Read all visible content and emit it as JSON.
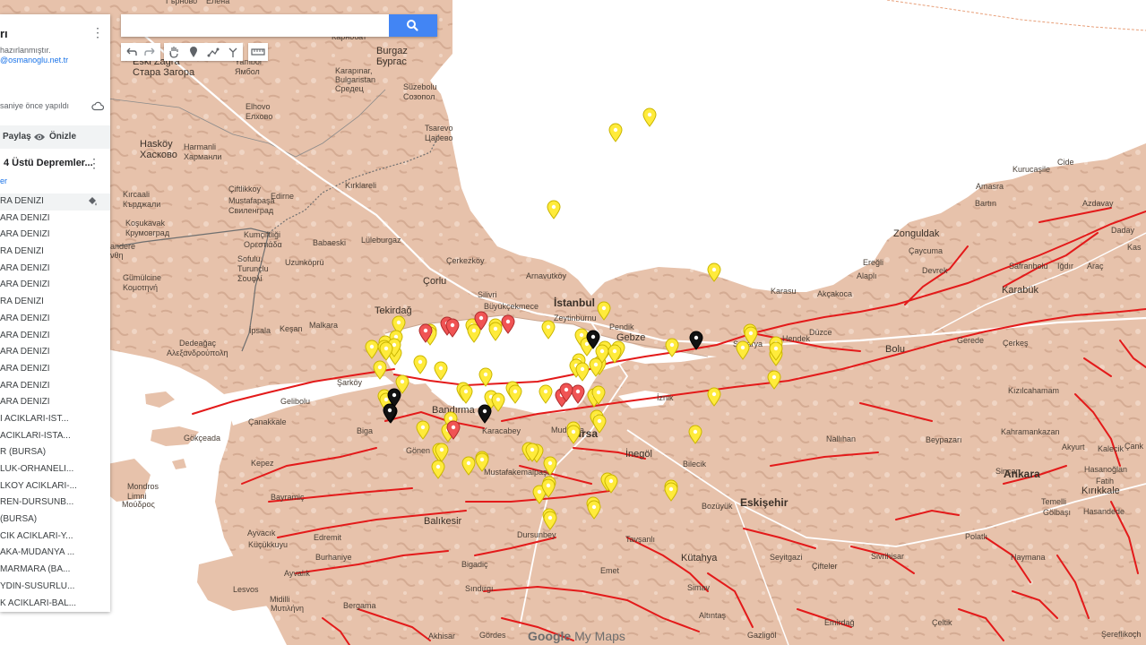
{
  "search": {
    "placeholder": ""
  },
  "panel": {
    "title": "rı",
    "description_line1": "hazırlanmıştır.",
    "description_line2": "@osmanoglu.net.tr",
    "saved_text": "saniye önce yapıldı",
    "share_label": "Paylaş",
    "preview_label": "Önizle",
    "layer_title": "4 Üstü Depremler...",
    "layer_sub": "er",
    "items": [
      "RA DENIZI",
      "ARA DENIZI",
      "ARA DENIZI",
      "RA DENIZI",
      "ARA DENIZI",
      "ARA DENIZI",
      "RA DENIZI",
      "ARA DENIZI",
      "ARA DENIZI",
      "ARA DENIZI",
      "ARA DENIZI",
      "ARA DENIZI",
      "ARA DENIZI",
      "I ACIKLARI-IST...",
      "ACIKLARI-ISTA...",
      "R (BURSA)",
      "LUK-ORHANELI...",
      "LKOY ACIKLARI-...",
      "REN-DURSUNB...",
      "(BURSA)",
      "CIK ACIKLARI-Y...",
      "AKA-MUDANYA ...",
      "MARMARA (BA...",
      "YDIN-SUSURLU...",
      "K ACIKLARI-BAL..."
    ]
  },
  "map": {
    "watermark_google": "Google",
    "watermark_mymaps": "My Maps",
    "labels": [
      {
        "t": "Гърново",
        "s": "sm"
      },
      {
        "t": "Елена",
        "s": "sm"
      },
      {
        "t": "Карнобат",
        "s": "sm"
      },
      {
        "t": "Burgaz",
        "s": "md"
      },
      {
        "t": "Бургас",
        "s": "md"
      },
      {
        "t": "Eski Zagra",
        "s": "md"
      },
      {
        "t": "Стара Загора",
        "s": "md"
      },
      {
        "t": "Yambol",
        "s": "sm"
      },
      {
        "t": "Ямбол",
        "s": "sm"
      },
      {
        "t": "Karapınar,",
        "s": "sm"
      },
      {
        "t": "Bulgaristan",
        "s": "sm"
      },
      {
        "t": "Средец",
        "s": "sm"
      },
      {
        "t": "Süzebolu",
        "s": "sm"
      },
      {
        "t": "Созопол",
        "s": "sm"
      },
      {
        "t": "Elhovo",
        "s": "sm"
      },
      {
        "t": "Елхово",
        "s": "sm"
      },
      {
        "t": "Tsarevo",
        "s": "sm"
      },
      {
        "t": "Царево",
        "s": "sm"
      },
      {
        "t": "Hasköy",
        "s": "md"
      },
      {
        "t": "Хасково",
        "s": "md"
      },
      {
        "t": "Harmanli",
        "s": "sm"
      },
      {
        "t": "Харманли",
        "s": "sm"
      },
      {
        "t": "Kırcaali",
        "s": "sm"
      },
      {
        "t": "Кърджали",
        "s": "sm"
      },
      {
        "t": "Kırklareli",
        "s": "sm"
      },
      {
        "t": "Koşukavak",
        "s": "sm"
      },
      {
        "t": "Крумовград",
        "s": "sm"
      },
      {
        "t": "Çiftlikkoy",
        "s": "sm"
      },
      {
        "t": "Mustafapaşa",
        "s": "sm"
      },
      {
        "t": "Свиленград",
        "s": "sm"
      },
      {
        "t": "Edirne",
        "s": "sm"
      },
      {
        "t": "Kumçiftliği",
        "s": "sm"
      },
      {
        "t": "Ορεστιάδα",
        "s": "sm"
      },
      {
        "t": "Babaeski",
        "s": "sm"
      },
      {
        "t": "Lüleburgaz",
        "s": "sm"
      },
      {
        "t": "Sofulu,",
        "s": "sm"
      },
      {
        "t": "Turunçlu",
        "s": "sm"
      },
      {
        "t": "Σουφλί",
        "s": "sm"
      },
      {
        "t": "Uzunköprü",
        "s": "sm"
      },
      {
        "t": "Gümülcine",
        "s": "sm"
      },
      {
        "t": "Κομοτηνή",
        "s": "sm"
      },
      {
        "t": "andere",
        "s": "sm"
      },
      {
        "t": "νθη",
        "s": "sm"
      },
      {
        "t": "Çerkezköy",
        "s": "sm"
      },
      {
        "t": "Arnavutköy",
        "s": "sm"
      },
      {
        "t": "Çorlu",
        "s": "md"
      },
      {
        "t": "Tekirdağ",
        "s": "md"
      },
      {
        "t": "Silivri",
        "s": "sm"
      },
      {
        "t": "Büyükçekmece",
        "s": "sm"
      },
      {
        "t": "İstanbul",
        "s": "lg"
      },
      {
        "t": "Zeytinburnu",
        "s": "sm"
      },
      {
        "t": "Pendik",
        "s": "sm"
      },
      {
        "t": "Gebze",
        "s": "md"
      },
      {
        "t": "İpsala",
        "s": "sm"
      },
      {
        "t": "Keşan",
        "s": "sm"
      },
      {
        "t": "Malkara",
        "s": "sm"
      },
      {
        "t": "Dedeağaç",
        "s": "sm"
      },
      {
        "t": "Αλεξανδρούπολη",
        "s": "sm"
      },
      {
        "t": "Şarköy",
        "s": "sm"
      },
      {
        "t": "Gelibolu",
        "s": "sm"
      },
      {
        "t": "Bandırma",
        "s": "md"
      },
      {
        "t": "Mudanya",
        "s": "sm"
      },
      {
        "t": "Bursa",
        "s": "lg"
      },
      {
        "t": "Karacabey",
        "s": "sm"
      },
      {
        "t": "Gökçeada",
        "s": "sm"
      },
      {
        "t": "Biga",
        "s": "sm"
      },
      {
        "t": "Çanakkale",
        "s": "sm"
      },
      {
        "t": "Gönen",
        "s": "sm"
      },
      {
        "t": "Kepez",
        "s": "sm"
      },
      {
        "t": "Mustafakemalpaşa",
        "s": "sm"
      },
      {
        "t": "Mondros",
        "s": "sm"
      },
      {
        "t": "Limni",
        "s": "sm"
      },
      {
        "t": "Μούδρος",
        "s": "sm"
      },
      {
        "t": "Bayramiç",
        "s": "sm"
      },
      {
        "t": "Balıkesir",
        "s": "md"
      },
      {
        "t": "Dursunbey",
        "s": "sm"
      },
      {
        "t": "Ayvacık",
        "s": "sm"
      },
      {
        "t": "Edremit",
        "s": "sm"
      },
      {
        "t": "Küçükkuyu",
        "s": "sm"
      },
      {
        "t": "Burhaniye",
        "s": "sm"
      },
      {
        "t": "Bigadiç",
        "s": "sm"
      },
      {
        "t": "Sındırgı",
        "s": "sm"
      },
      {
        "t": "Ayvalık",
        "s": "sm"
      },
      {
        "t": "Lesvos",
        "s": "sm"
      },
      {
        "t": "Midilli",
        "s": "sm"
      },
      {
        "t": "Μυτιλήνη",
        "s": "sm"
      },
      {
        "t": "Bergama",
        "s": "sm"
      },
      {
        "t": "Akhisar",
        "s": "sm"
      },
      {
        "t": "Gördes",
        "s": "sm"
      },
      {
        "t": "Emet",
        "s": "sm"
      },
      {
        "t": "Tavşanlı",
        "s": "sm"
      },
      {
        "t": "Kütahya",
        "s": "md"
      },
      {
        "t": "Simav",
        "s": "sm"
      },
      {
        "t": "Altıntaş",
        "s": "sm"
      },
      {
        "t": "İnegöl",
        "s": "md"
      },
      {
        "t": "Bilecik",
        "s": "sm"
      },
      {
        "t": "Bozüyük",
        "s": "sm"
      },
      {
        "t": "Eskişehir",
        "s": "lg"
      },
      {
        "t": "Seyitgazi",
        "s": "sm"
      },
      {
        "t": "Çifteler",
        "s": "sm"
      },
      {
        "t": "Emirdağ",
        "s": "sm"
      },
      {
        "t": "Gazligöl",
        "s": "sm"
      },
      {
        "t": "Sivrihisar",
        "s": "sm"
      },
      {
        "t": "Polatlı",
        "s": "sm"
      },
      {
        "t": "Haymana",
        "s": "sm"
      },
      {
        "t": "Çeltik",
        "s": "sm"
      },
      {
        "t": "İznik",
        "s": "sm"
      },
      {
        "t": "Sakarya",
        "s": "sm"
      },
      {
        "t": "Hendek",
        "s": "sm"
      },
      {
        "t": "Düzce",
        "s": "sm"
      },
      {
        "t": "Bolu",
        "s": "md"
      },
      {
        "t": "Gerede",
        "s": "sm"
      },
      {
        "t": "Çerkeş",
        "s": "sm"
      },
      {
        "t": "Nallıhan",
        "s": "sm"
      },
      {
        "t": "Beypazarı",
        "s": "sm"
      },
      {
        "t": "Kızılcahamam",
        "s": "sm"
      },
      {
        "t": "Kahramankazan",
        "s": "sm"
      },
      {
        "t": "Akyurt",
        "s": "sm"
      },
      {
        "t": "Ankara",
        "s": "lg"
      },
      {
        "t": "Sincan",
        "s": "sm"
      },
      {
        "t": "Temelli",
        "s": "sm"
      },
      {
        "t": "Gölbaşı",
        "s": "sm"
      },
      {
        "t": "Hasanoğlan",
        "s": "sm"
      },
      {
        "t": "Fatih",
        "s": "sm"
      },
      {
        "t": "Kırıkkale",
        "s": "md"
      },
      {
        "t": "Hasandede",
        "s": "sm"
      },
      {
        "t": "Kalecik",
        "s": "sm"
      },
      {
        "t": "Çank",
        "s": "sm"
      },
      {
        "t": "Zonguldak",
        "s": "md"
      },
      {
        "t": "Çaycuma",
        "s": "sm"
      },
      {
        "t": "Ereğli",
        "s": "sm"
      },
      {
        "t": "Alaplı",
        "s": "sm"
      },
      {
        "t": "Devrek",
        "s": "sm"
      },
      {
        "t": "Safranbolu",
        "s": "sm"
      },
      {
        "t": "Karabük",
        "s": "md"
      },
      {
        "t": "Iğdır",
        "s": "sm"
      },
      {
        "t": "Araç",
        "s": "sm"
      },
      {
        "t": "Karasu",
        "s": "sm"
      },
      {
        "t": "Akçakoca",
        "s": "sm"
      },
      {
        "t": "Amasra",
        "s": "sm"
      },
      {
        "t": "Bartın",
        "s": "sm"
      },
      {
        "t": "Kurucaşile",
        "s": "sm"
      },
      {
        "t": "Cide",
        "s": "sm"
      },
      {
        "t": "Azdavay",
        "s": "sm"
      },
      {
        "t": "Daday",
        "s": "sm"
      },
      {
        "t": "Kas",
        "s": "sm"
      },
      {
        "t": "Şereflikoçh",
        "s": "sm"
      }
    ],
    "markers": {
      "yellow": 86,
      "red": 9,
      "black": 6
    }
  }
}
